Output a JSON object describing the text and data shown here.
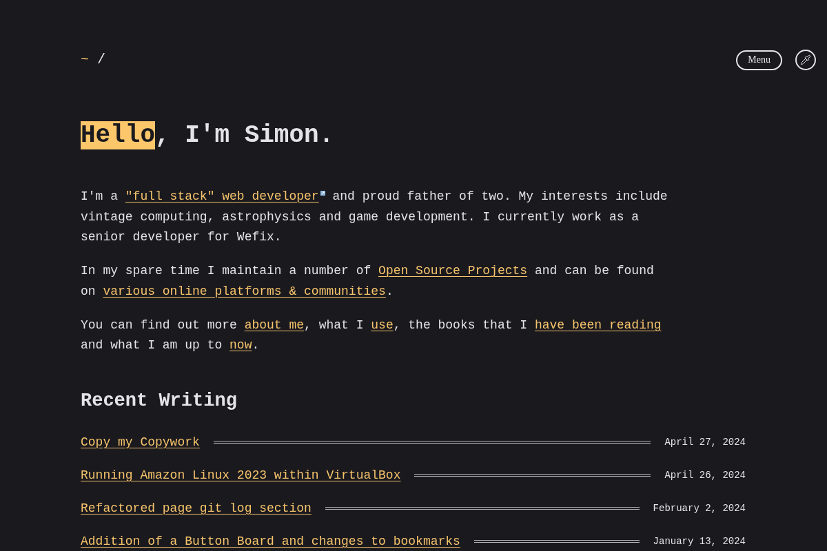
{
  "header": {
    "logo": {
      "tilde": "~",
      "slash": "/"
    },
    "menu_button": "Menu"
  },
  "heading": {
    "highlight": "Hello",
    "rest": ", I'm Simon."
  },
  "intro": {
    "paragraphs": [
      {
        "segments": [
          {
            "kind": "text",
            "text": "I'm a "
          },
          {
            "kind": "external_link",
            "text": "\"full stack\" web developer"
          },
          {
            "kind": "text",
            "text": " and proud father of two. My interests include vintage computing, astrophysics and game development. I currently work as a senior developer for Wefix."
          }
        ]
      },
      {
        "segments": [
          {
            "kind": "text",
            "text": "In my spare time I maintain a number of "
          },
          {
            "kind": "link",
            "text": "Open Source Projects"
          },
          {
            "kind": "text",
            "text": " and can be found on "
          },
          {
            "kind": "link",
            "text": "various online platforms & communities"
          },
          {
            "kind": "text",
            "text": "."
          }
        ]
      },
      {
        "segments": [
          {
            "kind": "text",
            "text": "You can find out more "
          },
          {
            "kind": "link",
            "text": "about me"
          },
          {
            "kind": "text",
            "text": ", what I "
          },
          {
            "kind": "link",
            "text": "use"
          },
          {
            "kind": "text",
            "text": ", the books that I "
          },
          {
            "kind": "link",
            "text": "have been reading"
          },
          {
            "kind": "text",
            "text": " and what I am up to "
          },
          {
            "kind": "link",
            "text": "now"
          },
          {
            "kind": "text",
            "text": "."
          }
        ]
      }
    ]
  },
  "recent_writing": {
    "title": "Recent Writing",
    "posts": [
      {
        "title": "Copy my Copywork",
        "date": "April 27, 2024"
      },
      {
        "title": "Running Amazon Linux 2023 within VirtualBox",
        "date": "April 26, 2024"
      },
      {
        "title": "Refactored page git log section",
        "date": "February 2, 2024"
      },
      {
        "title": "Addition of a Button Board and changes to bookmarks",
        "date": "January 13, 2024"
      }
    ]
  }
}
